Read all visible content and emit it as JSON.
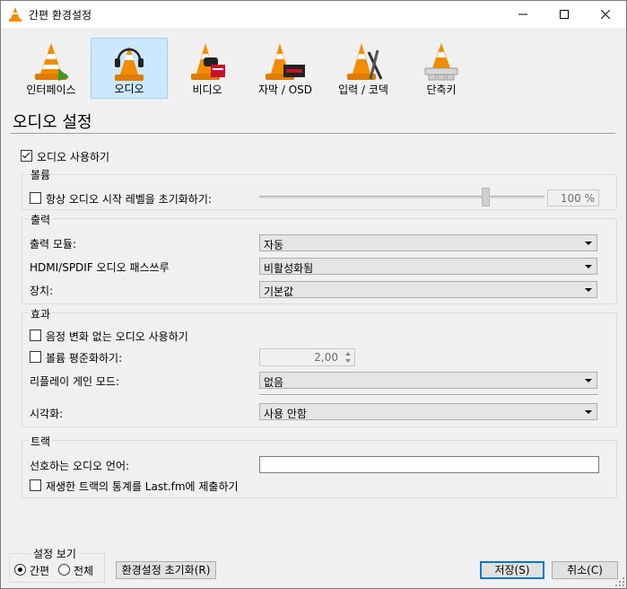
{
  "window": {
    "title": "간편 환경설정"
  },
  "categories": [
    {
      "label": "인터페이스",
      "icon": "interface-cone-icon",
      "selected": false
    },
    {
      "label": "오디오",
      "icon": "audio-cone-icon",
      "selected": true
    },
    {
      "label": "비디오",
      "icon": "video-cone-icon",
      "selected": false
    },
    {
      "label": "자막 / OSD",
      "icon": "subtitle-cone-icon",
      "selected": false
    },
    {
      "label": "입력 / 코덱",
      "icon": "input-codec-cone-icon",
      "selected": false
    },
    {
      "label": "단축키",
      "icon": "hotkeys-cone-icon",
      "selected": false
    }
  ],
  "page": {
    "heading": "오디오 설정"
  },
  "audio": {
    "enable_label": "오디오 사용하기",
    "enabled": true
  },
  "volume": {
    "title": "볼륨",
    "reset_label": "항상 오디오 시작 레벨을 초기화하기:",
    "reset_checked": false,
    "level_percent": 100,
    "level_text": "100 %"
  },
  "output": {
    "title": "출력",
    "module_label": "출력 모듈:",
    "module_value": "자동",
    "passthrough_label": "HDMI/SPDIF 오디오 패스쓰루",
    "passthrough_value": "비활성화됨",
    "device_label": "장치:",
    "device_value": "기본값"
  },
  "effects": {
    "title": "효과",
    "pitch_label": "음정 변화 없는 오디오 사용하기",
    "pitch_checked": false,
    "normalize_label": "볼륨  평준화하기:",
    "normalize_checked": false,
    "normalize_value": "2,00",
    "replay_label": "리플레이 게인 모드:",
    "replay_value": "없음",
    "visual_label": "시각화:",
    "visual_value": "사용 안함"
  },
  "tracks": {
    "title": "트랙",
    "lang_label": "선호하는 오디오 언어:",
    "lang_value": "",
    "lastfm_label": "재생한 트랙의 통계를 Last.fm에 제출하기",
    "lastfm_checked": false
  },
  "footer": {
    "view_title": "설정 보기",
    "simple_label": "간편",
    "all_label": "전체",
    "reset_label": "환경설정 초기화(R)",
    "save_label": "저장(S)",
    "cancel_label": "취소(C)"
  },
  "colors": {
    "selection_bg": "#cce8ff",
    "selection_border": "#99d1ff",
    "vlc_orange": "#f28c00",
    "default_button_border": "#0078d7"
  }
}
